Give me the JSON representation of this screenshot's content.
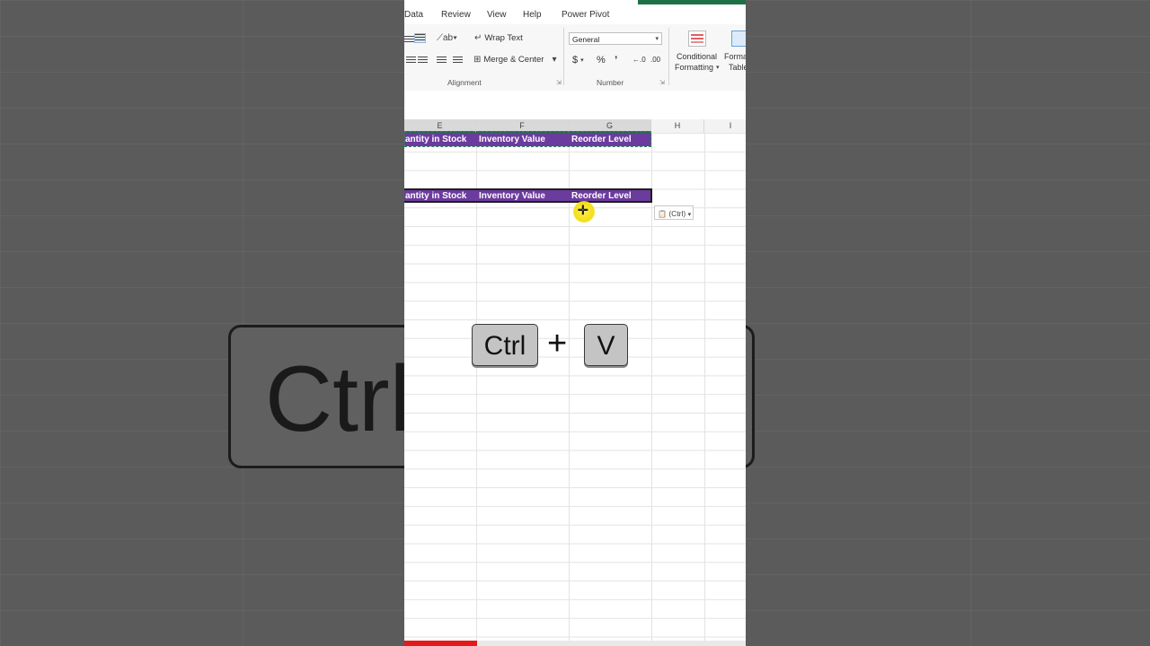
{
  "ribbon": {
    "tabs": [
      "Data",
      "Review",
      "View",
      "Help",
      "Power Pivot"
    ],
    "wrap_text": "Wrap Text",
    "merge_center": "Merge & Center",
    "number_format": "General",
    "conditional_formatting_line1": "Conditional",
    "conditional_formatting_line2": "Formatting",
    "format_table_line1": "Format as",
    "format_table_line2": "Table",
    "group_alignment": "Alignment",
    "group_number": "Number",
    "currency_symbol": "$",
    "percent_symbol": "%",
    "comma_symbol": "’",
    "increase_decimal": "←.0",
    "decrease_decimal": ".00"
  },
  "columns": [
    "E",
    "F",
    "G",
    "H",
    "I"
  ],
  "header_row_1": [
    "antity in Stock",
    "Inventory Value",
    "Reorder Level"
  ],
  "header_row_2": [
    "antity in Stock",
    "Inventory Value",
    "Reorder Level"
  ],
  "paste_options_label": "(Ctrl)",
  "shortcut": {
    "key1": "Ctrl",
    "plus": "+",
    "key2": "V"
  },
  "background_key_text": "Ctrl",
  "colors": {
    "header_purple": "#6b3b9e",
    "excel_green": "#1e7145",
    "progress_red": "#e31b1b"
  }
}
